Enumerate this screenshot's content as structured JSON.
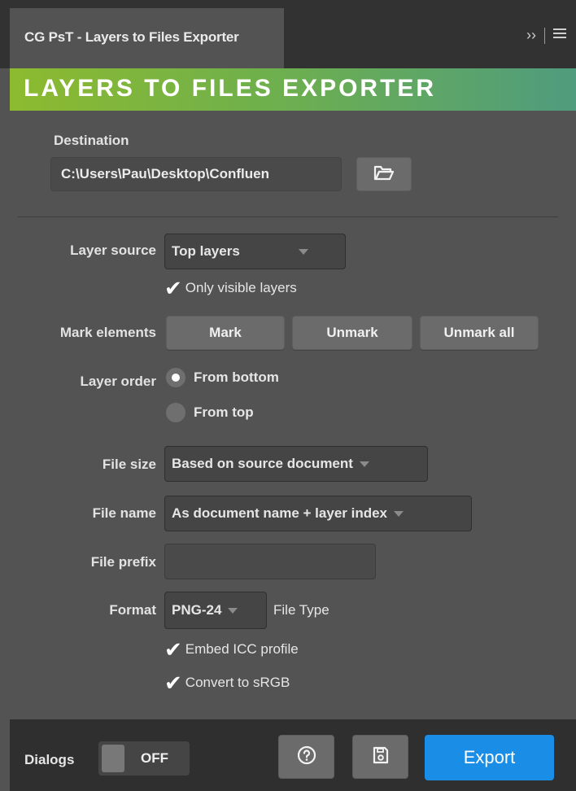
{
  "panel": {
    "tab_title": "CG PsT - Layers to Files Exporter",
    "tab_overflow": "››",
    "banner_title": "LAYERS TO FILES EXPORTER"
  },
  "destination": {
    "label": "Destination",
    "path": "C:\\Users\\Pau\\Desktop\\Confluen",
    "browse_icon": "folder-open-icon"
  },
  "layer_source": {
    "label": "Layer source",
    "selected": "Top layers",
    "only_visible_label": "Only visible layers",
    "only_visible_checked": true
  },
  "mark_elements": {
    "label": "Mark elements",
    "mark": "Mark",
    "unmark": "Unmark",
    "unmark_all": "Unmark all"
  },
  "layer_order": {
    "label": "Layer order",
    "options": [
      "From bottom",
      "From top"
    ],
    "selected_index": 0
  },
  "file_size": {
    "label": "File size",
    "selected": "Based on source document"
  },
  "file_name": {
    "label": "File name",
    "selected": "As document name + layer index"
  },
  "file_prefix": {
    "label": "File prefix",
    "value": ""
  },
  "format": {
    "label": "Format",
    "selected": "PNG-24",
    "type_label": "File Type",
    "embed_icc_label": "Embed ICC profile",
    "embed_icc_checked": true,
    "convert_srgb_label": "Convert to sRGB",
    "convert_srgb_checked": true
  },
  "footer": {
    "dialogs_label": "Dialogs",
    "dialogs_state": "OFF",
    "help_icon": "help-icon",
    "save_icon": "save-icon",
    "export_label": "Export"
  },
  "colors": {
    "panel_bg": "#535353",
    "banner_gradient_start": "#8dba2f",
    "banner_gradient_end": "#4f9c7e",
    "export_button": "#1a8ee6"
  }
}
